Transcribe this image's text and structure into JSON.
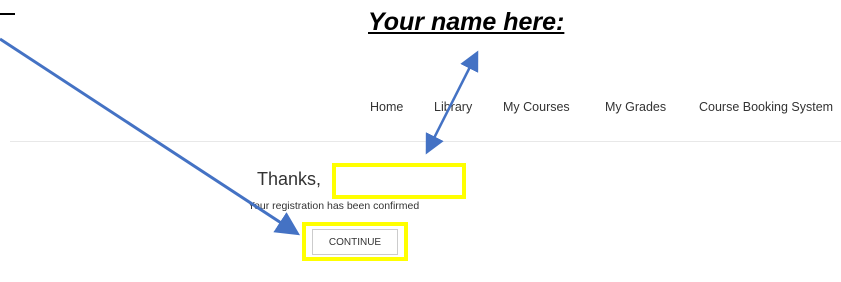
{
  "annotation": {
    "title": "Your name here:",
    "highlight_color": "#ffff00",
    "arrow_color": "#4472c4"
  },
  "nav": {
    "items": [
      {
        "label": "Home"
      },
      {
        "label": "Library"
      },
      {
        "label": "My Courses"
      },
      {
        "label": "My Grades"
      },
      {
        "label": "Course Booking System"
      }
    ]
  },
  "main": {
    "thanks_text": "Thanks,",
    "name_value": "",
    "confirmation_text": "Your registration has been confirmed",
    "continue_label": "CONTINUE"
  }
}
